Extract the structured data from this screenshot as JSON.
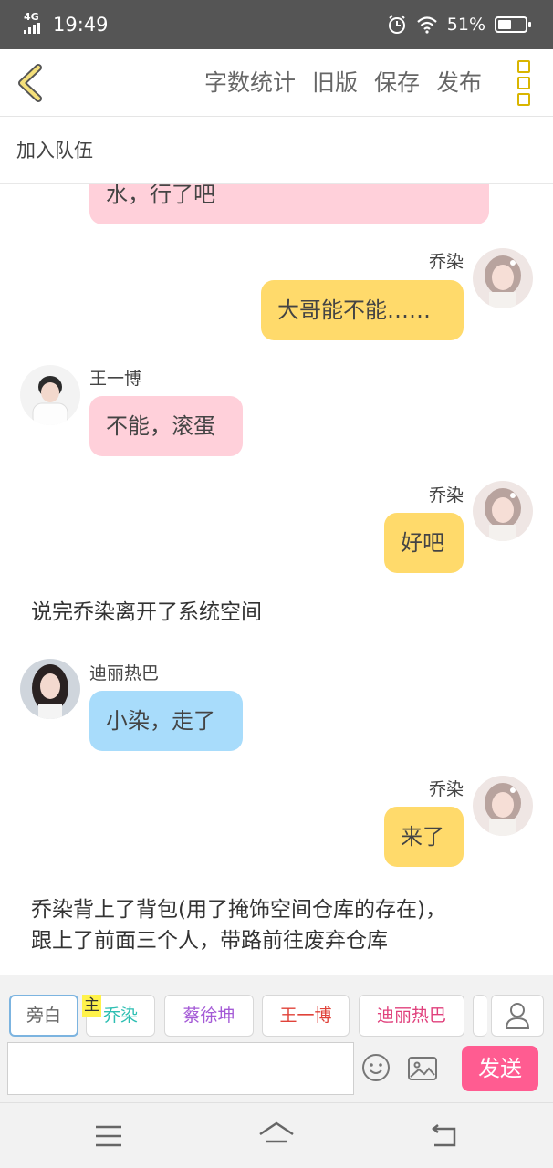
{
  "status_bar": {
    "network": "4G",
    "time": "19:49",
    "battery": "51%",
    "battery_level": 0.51
  },
  "toolbar": {
    "actions": [
      "字数统计",
      "旧版",
      "保存",
      "发布"
    ]
  },
  "team": {
    "join_label": "加入队伍"
  },
  "messages": [
    {
      "type": "bubble",
      "side": "left",
      "color": "#ffd0da",
      "text": "水，行了吧"
    },
    {
      "type": "bubble",
      "side": "right",
      "speaker": "乔染",
      "color": "#ffda6b",
      "text": "大哥能不能……"
    },
    {
      "type": "bubble",
      "side": "left",
      "speaker": "王一博",
      "color": "#ffd0da",
      "text": "不能，滚蛋"
    },
    {
      "type": "bubble",
      "side": "right",
      "speaker": "乔染",
      "color": "#ffda6b",
      "text": "好吧"
    },
    {
      "type": "narration",
      "text": "说完乔染离开了系统空间"
    },
    {
      "type": "bubble",
      "side": "left",
      "speaker": "迪丽热巴",
      "color": "#a8dcfb",
      "text": "小染，走了"
    },
    {
      "type": "bubble",
      "side": "right",
      "speaker": "乔染",
      "color": "#ffda6b",
      "text": "来了"
    },
    {
      "type": "narration",
      "lines": [
        "乔染背上了背包(用了掩饰空间仓库的存在)，",
        "跟上了前面三个人，带路前往废弃仓库"
      ]
    }
  ],
  "roles": {
    "main_tag": "主",
    "chips": [
      {
        "label": "旁白",
        "color": "#666666",
        "selected": true
      },
      {
        "label": "乔染",
        "color": "#2ebfb3"
      },
      {
        "label": "蔡徐坤",
        "color": "#a45ad6"
      },
      {
        "label": "王一博",
        "color": "#e0433a"
      },
      {
        "label": "迪丽热巴",
        "color": "#e0407c"
      }
    ]
  },
  "composer": {
    "input_value": "",
    "send_label": "发送"
  }
}
